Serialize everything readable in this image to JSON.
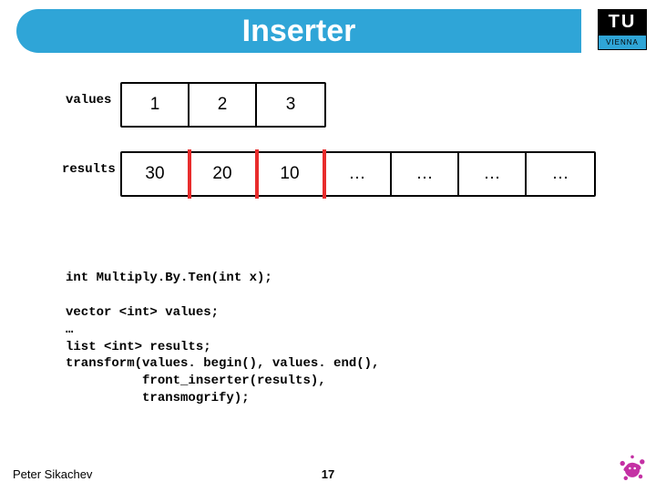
{
  "title": "Inserter",
  "logo": {
    "top": "TU",
    "bottom": "VIENNA"
  },
  "values": {
    "label": "values",
    "cells": [
      "1",
      "2",
      "3"
    ]
  },
  "results": {
    "label": "results",
    "cells": [
      "30",
      "20",
      "10",
      "…",
      "…",
      "…",
      "…"
    ]
  },
  "code": "int Multiply.By.Ten(int x);\n\nvector <int> values;\n…\nlist <int> results;\ntransform(values. begin(), values. end(),\n          front_inserter(results),\n          transmogrify);",
  "footer": {
    "author": "Peter Sikachev",
    "page": "17"
  }
}
